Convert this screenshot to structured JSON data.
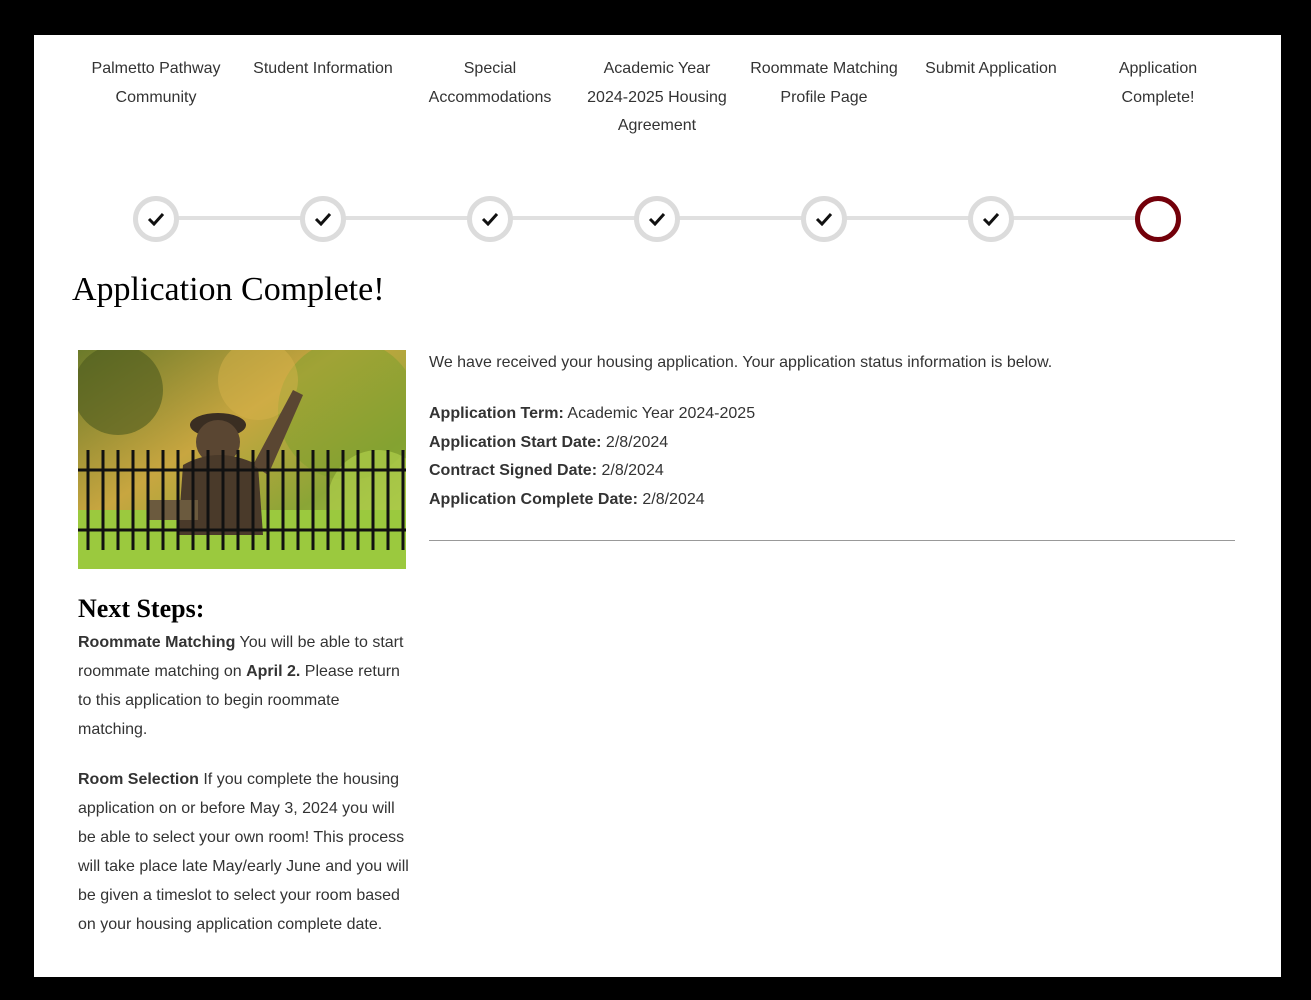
{
  "steps": [
    {
      "label": "Palmetto Pathway Community",
      "state": "done"
    },
    {
      "label": "Student Information",
      "state": "done"
    },
    {
      "label": "Special Accommodations",
      "state": "done"
    },
    {
      "label": "Academic Year 2024-2025 Housing Agreement",
      "state": "done"
    },
    {
      "label": "Roommate Matching Profile Page",
      "state": "done"
    },
    {
      "label": "Submit Application",
      "state": "done"
    },
    {
      "label": "Application Complete!",
      "state": "current"
    }
  ],
  "colors": {
    "accent": "#73000a",
    "done_ring": "#dcdcdc",
    "track": "#e0e0e0"
  },
  "page_title": "Application Complete!",
  "status": {
    "intro": "We have received your housing application. Your application status information is below.",
    "rows": [
      {
        "label": "Application Term:",
        "value": "Academic Year 2024-2025"
      },
      {
        "label": "Application Start Date:",
        "value": "2/8/2024"
      },
      {
        "label": "Contract Signed Date:",
        "value": "2/8/2024"
      },
      {
        "label": "Application Complete Date:",
        "value": "2/8/2024"
      }
    ]
  },
  "next_steps": {
    "title": "Next Steps:",
    "roommate": {
      "heading": "Roommate Matching",
      "text_before": "You will be able to start roommate matching on",
      "date": "April 2.",
      "text_after": "Please return to this application to begin roommate matching."
    },
    "room": {
      "heading": "Room Selection",
      "text": "If you complete the housing application on or before May 3, 2024 you will be able to select your own room! This process will take place late May/early June and you will be given a timeslot to select your room based on your housing application complete date."
    }
  },
  "photo_icon": "mascot-statue-photo"
}
